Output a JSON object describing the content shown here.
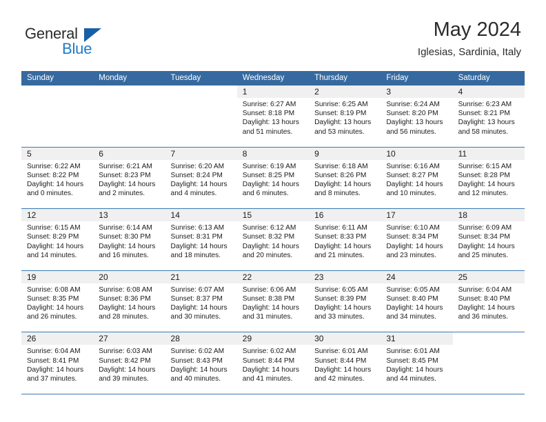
{
  "logo": {
    "word1": "General",
    "word2": "Blue",
    "icon": "triangle-icon"
  },
  "header": {
    "title": "May 2024",
    "subtitle": "Iglesias, Sardinia, Italy"
  },
  "colors": {
    "header_blue": "#36699f",
    "week_divider": "#3b79b5",
    "daynum_band": "#f0f0f0",
    "logo_blue": "#1f7ac4",
    "text": "#1a1a1a"
  },
  "calendar": {
    "day_names": [
      "Sunday",
      "Monday",
      "Tuesday",
      "Wednesday",
      "Thursday",
      "Friday",
      "Saturday"
    ],
    "labels": {
      "sunrise": "Sunrise:",
      "sunset": "Sunset:",
      "daylight": "Daylight:"
    },
    "weeks": [
      [
        {
          "empty": true
        },
        {
          "empty": true
        },
        {
          "empty": true
        },
        {
          "day": "1",
          "sunrise": "Sunrise: 6:27 AM",
          "sunset": "Sunset: 8:18 PM",
          "daylight1": "Daylight: 13 hours",
          "daylight2": "and 51 minutes."
        },
        {
          "day": "2",
          "sunrise": "Sunrise: 6:25 AM",
          "sunset": "Sunset: 8:19 PM",
          "daylight1": "Daylight: 13 hours",
          "daylight2": "and 53 minutes."
        },
        {
          "day": "3",
          "sunrise": "Sunrise: 6:24 AM",
          "sunset": "Sunset: 8:20 PM",
          "daylight1": "Daylight: 13 hours",
          "daylight2": "and 56 minutes."
        },
        {
          "day": "4",
          "sunrise": "Sunrise: 6:23 AM",
          "sunset": "Sunset: 8:21 PM",
          "daylight1": "Daylight: 13 hours",
          "daylight2": "and 58 minutes."
        }
      ],
      [
        {
          "day": "5",
          "sunrise": "Sunrise: 6:22 AM",
          "sunset": "Sunset: 8:22 PM",
          "daylight1": "Daylight: 14 hours",
          "daylight2": "and 0 minutes."
        },
        {
          "day": "6",
          "sunrise": "Sunrise: 6:21 AM",
          "sunset": "Sunset: 8:23 PM",
          "daylight1": "Daylight: 14 hours",
          "daylight2": "and 2 minutes."
        },
        {
          "day": "7",
          "sunrise": "Sunrise: 6:20 AM",
          "sunset": "Sunset: 8:24 PM",
          "daylight1": "Daylight: 14 hours",
          "daylight2": "and 4 minutes."
        },
        {
          "day": "8",
          "sunrise": "Sunrise: 6:19 AM",
          "sunset": "Sunset: 8:25 PM",
          "daylight1": "Daylight: 14 hours",
          "daylight2": "and 6 minutes."
        },
        {
          "day": "9",
          "sunrise": "Sunrise: 6:18 AM",
          "sunset": "Sunset: 8:26 PM",
          "daylight1": "Daylight: 14 hours",
          "daylight2": "and 8 minutes."
        },
        {
          "day": "10",
          "sunrise": "Sunrise: 6:16 AM",
          "sunset": "Sunset: 8:27 PM",
          "daylight1": "Daylight: 14 hours",
          "daylight2": "and 10 minutes."
        },
        {
          "day": "11",
          "sunrise": "Sunrise: 6:15 AM",
          "sunset": "Sunset: 8:28 PM",
          "daylight1": "Daylight: 14 hours",
          "daylight2": "and 12 minutes."
        }
      ],
      [
        {
          "day": "12",
          "sunrise": "Sunrise: 6:15 AM",
          "sunset": "Sunset: 8:29 PM",
          "daylight1": "Daylight: 14 hours",
          "daylight2": "and 14 minutes."
        },
        {
          "day": "13",
          "sunrise": "Sunrise: 6:14 AM",
          "sunset": "Sunset: 8:30 PM",
          "daylight1": "Daylight: 14 hours",
          "daylight2": "and 16 minutes."
        },
        {
          "day": "14",
          "sunrise": "Sunrise: 6:13 AM",
          "sunset": "Sunset: 8:31 PM",
          "daylight1": "Daylight: 14 hours",
          "daylight2": "and 18 minutes."
        },
        {
          "day": "15",
          "sunrise": "Sunrise: 6:12 AM",
          "sunset": "Sunset: 8:32 PM",
          "daylight1": "Daylight: 14 hours",
          "daylight2": "and 20 minutes."
        },
        {
          "day": "16",
          "sunrise": "Sunrise: 6:11 AM",
          "sunset": "Sunset: 8:33 PM",
          "daylight1": "Daylight: 14 hours",
          "daylight2": "and 21 minutes."
        },
        {
          "day": "17",
          "sunrise": "Sunrise: 6:10 AM",
          "sunset": "Sunset: 8:34 PM",
          "daylight1": "Daylight: 14 hours",
          "daylight2": "and 23 minutes."
        },
        {
          "day": "18",
          "sunrise": "Sunrise: 6:09 AM",
          "sunset": "Sunset: 8:34 PM",
          "daylight1": "Daylight: 14 hours",
          "daylight2": "and 25 minutes."
        }
      ],
      [
        {
          "day": "19",
          "sunrise": "Sunrise: 6:08 AM",
          "sunset": "Sunset: 8:35 PM",
          "daylight1": "Daylight: 14 hours",
          "daylight2": "and 26 minutes."
        },
        {
          "day": "20",
          "sunrise": "Sunrise: 6:08 AM",
          "sunset": "Sunset: 8:36 PM",
          "daylight1": "Daylight: 14 hours",
          "daylight2": "and 28 minutes."
        },
        {
          "day": "21",
          "sunrise": "Sunrise: 6:07 AM",
          "sunset": "Sunset: 8:37 PM",
          "daylight1": "Daylight: 14 hours",
          "daylight2": "and 30 minutes."
        },
        {
          "day": "22",
          "sunrise": "Sunrise: 6:06 AM",
          "sunset": "Sunset: 8:38 PM",
          "daylight1": "Daylight: 14 hours",
          "daylight2": "and 31 minutes."
        },
        {
          "day": "23",
          "sunrise": "Sunrise: 6:05 AM",
          "sunset": "Sunset: 8:39 PM",
          "daylight1": "Daylight: 14 hours",
          "daylight2": "and 33 minutes."
        },
        {
          "day": "24",
          "sunrise": "Sunrise: 6:05 AM",
          "sunset": "Sunset: 8:40 PM",
          "daylight1": "Daylight: 14 hours",
          "daylight2": "and 34 minutes."
        },
        {
          "day": "25",
          "sunrise": "Sunrise: 6:04 AM",
          "sunset": "Sunset: 8:40 PM",
          "daylight1": "Daylight: 14 hours",
          "daylight2": "and 36 minutes."
        }
      ],
      [
        {
          "day": "26",
          "sunrise": "Sunrise: 6:04 AM",
          "sunset": "Sunset: 8:41 PM",
          "daylight1": "Daylight: 14 hours",
          "daylight2": "and 37 minutes."
        },
        {
          "day": "27",
          "sunrise": "Sunrise: 6:03 AM",
          "sunset": "Sunset: 8:42 PM",
          "daylight1": "Daylight: 14 hours",
          "daylight2": "and 39 minutes."
        },
        {
          "day": "28",
          "sunrise": "Sunrise: 6:02 AM",
          "sunset": "Sunset: 8:43 PM",
          "daylight1": "Daylight: 14 hours",
          "daylight2": "and 40 minutes."
        },
        {
          "day": "29",
          "sunrise": "Sunrise: 6:02 AM",
          "sunset": "Sunset: 8:44 PM",
          "daylight1": "Daylight: 14 hours",
          "daylight2": "and 41 minutes."
        },
        {
          "day": "30",
          "sunrise": "Sunrise: 6:01 AM",
          "sunset": "Sunset: 8:44 PM",
          "daylight1": "Daylight: 14 hours",
          "daylight2": "and 42 minutes."
        },
        {
          "day": "31",
          "sunrise": "Sunrise: 6:01 AM",
          "sunset": "Sunset: 8:45 PM",
          "daylight1": "Daylight: 14 hours",
          "daylight2": "and 44 minutes."
        },
        {
          "empty": true
        }
      ]
    ]
  }
}
